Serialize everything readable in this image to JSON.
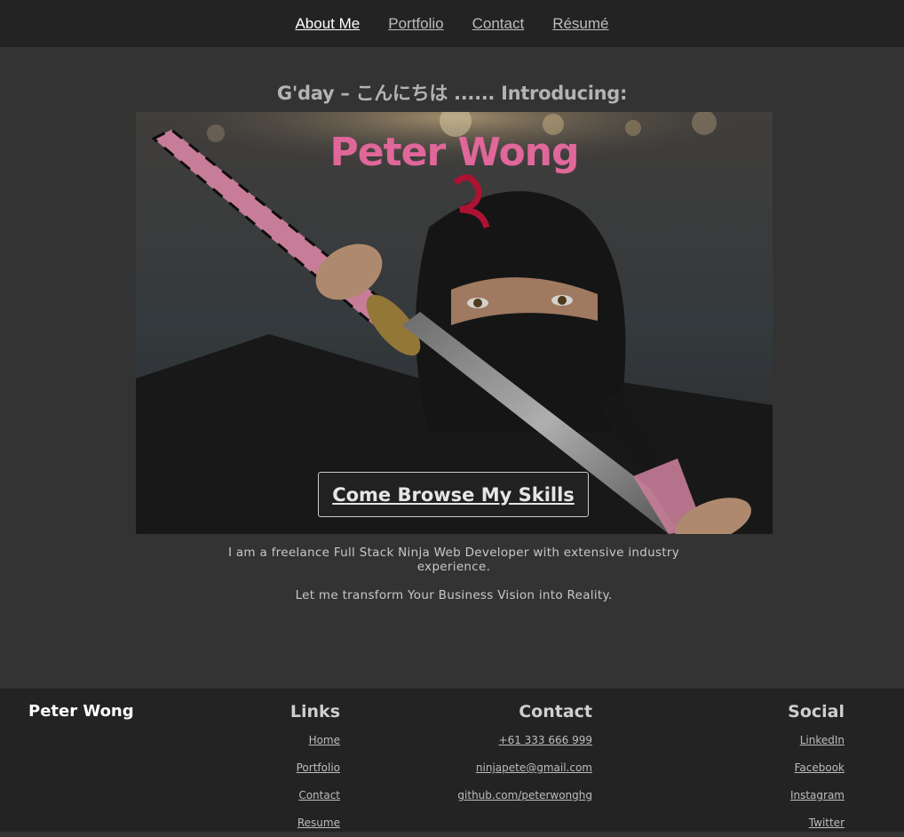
{
  "nav": {
    "items": [
      {
        "label": "About Me",
        "active": true
      },
      {
        "label": "Portfolio",
        "active": false
      },
      {
        "label": "Contact",
        "active": false
      },
      {
        "label": "Résumé",
        "active": false
      }
    ]
  },
  "hero": {
    "intro": "G'day – こんにちは ...... Introducing:",
    "name": "Peter Wong",
    "cta_label": "Come Browse My Skills"
  },
  "description": {
    "line1": "I am a freelance Full Stack Ninja Web Developer with extensive industry experience.",
    "line2": "Let me transform Your Business Vision into Reality."
  },
  "footer": {
    "brand": "Peter Wong",
    "links": {
      "title": "Links",
      "items": [
        "Home",
        "Portfolio",
        "Contact",
        "Resume"
      ]
    },
    "contact": {
      "title": "Contact",
      "items": [
        "+61 333 666 999",
        "ninjapete@gmail.com",
        "github.com/peterwonghg"
      ]
    },
    "social": {
      "title": "Social",
      "items": [
        "LinkedIn",
        "Facebook",
        "Instagram",
        "Twitter"
      ]
    }
  },
  "colors": {
    "accent_pink": "#e0679a",
    "page_bg": "#333333",
    "nav_bg": "#232323"
  }
}
